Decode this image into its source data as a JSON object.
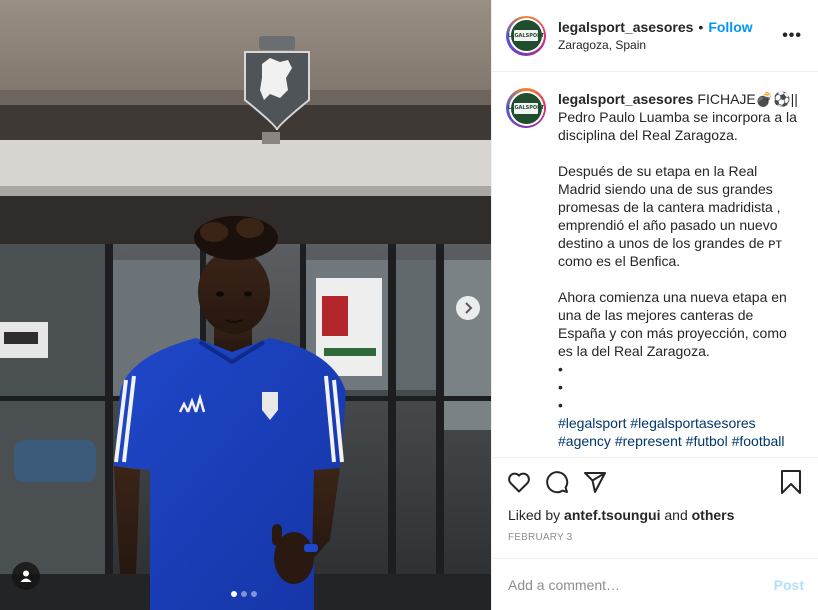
{
  "post": {
    "username": "legalsport_asesores",
    "separator": "•",
    "follow_label": "Follow",
    "location": "Zaragoza, Spain",
    "more_label": "•••",
    "avatar_icon": "legalsport-logo-icon",
    "avatar_text": "LEGALSPORT"
  },
  "caption": {
    "username": "legalsport_asesores",
    "lead": "FICHAJE💣⚽||",
    "body": "Pedro Paulo Luamba se incorpora a la disciplina del Real Zaragoza.\n\nDespués de su etapa en la Real Madrid siendo una de sus grandes promesas de la cantera madridista , emprendió el año pasado un nuevo destino a unos de los grandes de ᴘᴛ como es el Benfica.\n\nAhora comienza una nueva etapa en una de las mejores canteras de España y con más proyección, como es la del Real Zaragoza.\n•\n•\n•",
    "hashtags": [
      "#legalsport",
      "#legalsportasesores",
      "#agency",
      "#represent",
      "#futbol",
      "#football"
    ]
  },
  "actions": {
    "like_icon": "heart-icon",
    "comment_icon": "comment-icon",
    "share_icon": "share-icon",
    "save_icon": "bookmark-icon"
  },
  "likes": {
    "prefix": "Liked by",
    "user": "antef.tsoungui",
    "joiner": "and",
    "others": "others"
  },
  "date": "FEBRUARY 3",
  "comment": {
    "placeholder": "Add a comment…",
    "post_label": "Post"
  },
  "carousel": {
    "total": 3,
    "active_index": 0,
    "next_icon": "chevron-right-icon",
    "tag_icon": "user-tag-icon"
  },
  "colors": {
    "accent": "#0095f6",
    "hashtag": "#00376b",
    "muted": "#8e8e8e",
    "post_disabled": "#b2dffc",
    "border": "#efefef"
  }
}
